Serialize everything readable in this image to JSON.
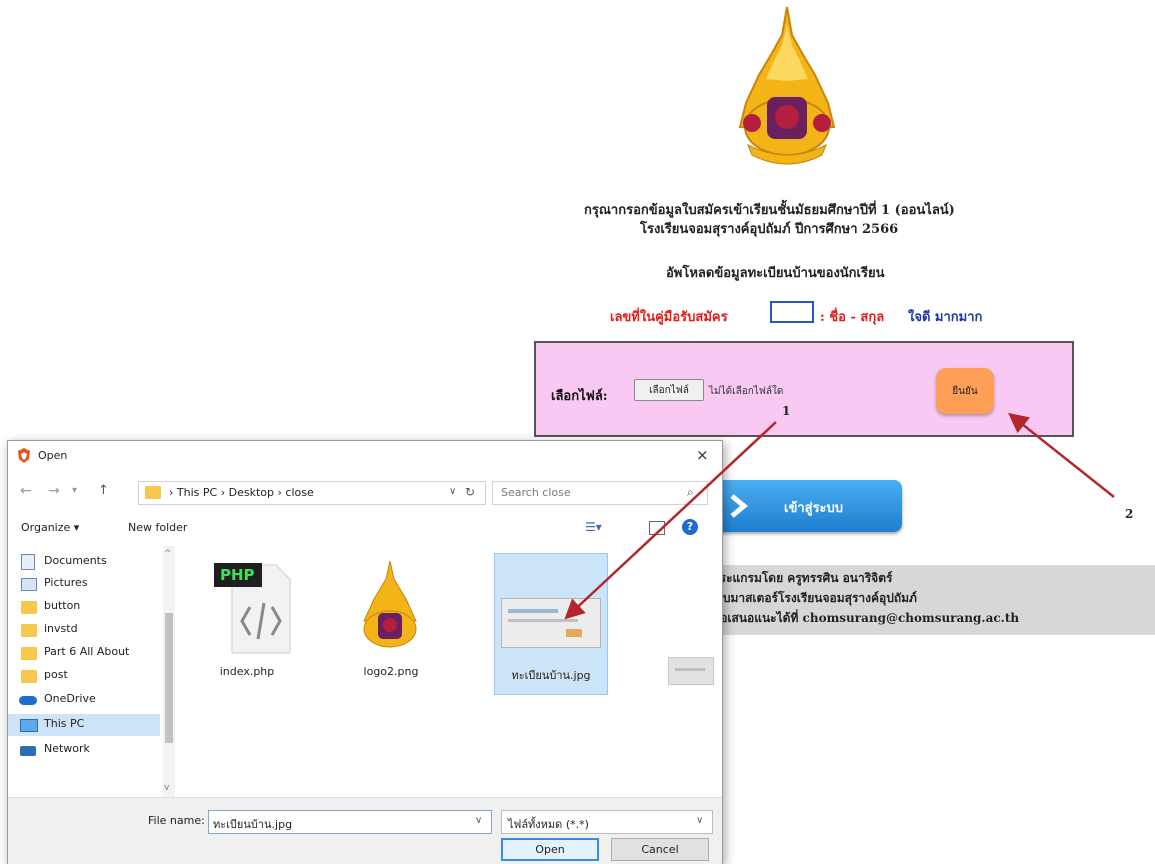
{
  "page": {
    "heading_line1": "กรุณากรอกข้อมูลใบสมัครเข้าเรียนชั้นมัธยมศึกษาปีที่ 1 (ออนไลน์)",
    "heading_line2": "โรงเรียนจอมสุรางค์อุปถัมภ์ ปีการศึกษา 2566",
    "upload_heading": "อัพโหลดข้อมูลทะเบียนบ้านของนักเรียน",
    "reg_label": "เลขที่ในคู่มือรับสมัคร",
    "reg_value": "",
    "name_label": ": ชื่อ - สกุล",
    "name_value": "ใจดี มากมาก",
    "choose_file_label": "เลือกไฟล์:",
    "choose_file_button": "เลือกไฟล์",
    "no_file_text": "ไม่ได้เลือกไฟล์ใด",
    "confirm_button": "ยืนยัน",
    "next_button": "เข้าสู่ระบบ",
    "footer_line1": "ประแกรมโดย ครูทรรศิน อนาริจิตร์",
    "footer_line2": "เว็บมาสเตอร์โรงเรียนจอมสุรางค์อุปถัมภ์",
    "footer_line3": "ข้อเสนอแนะได้ที่ chomsurang@chomsurang.ac.th",
    "annotation1": "1",
    "annotation2": "2",
    "annotation_color": "#b3262e"
  },
  "dialog": {
    "title": "Open",
    "close": "×",
    "breadcrumb": [
      "This PC",
      "Desktop",
      "close"
    ],
    "search_placeholder": "Search close",
    "organize": "Organize ▾",
    "new_folder": "New folder",
    "sidebar": [
      {
        "label": "Documents",
        "icon": "documents-icon"
      },
      {
        "label": "Pictures",
        "icon": "pictures-icon"
      },
      {
        "label": "button",
        "icon": "folder-icon"
      },
      {
        "label": "invstd",
        "icon": "folder-icon"
      },
      {
        "label": "Part 6 All About",
        "icon": "folder-icon"
      },
      {
        "label": "post",
        "icon": "folder-icon"
      },
      {
        "label": "OneDrive",
        "icon": "onedrive-icon"
      },
      {
        "label": "This PC",
        "icon": "this-pc-icon"
      },
      {
        "label": "Network",
        "icon": "network-icon"
      }
    ],
    "files": [
      {
        "name": "index.php",
        "badge": "PHP"
      },
      {
        "name": "logo2.png"
      },
      {
        "name": "ทะเบียนบ้าน.jpg"
      }
    ],
    "file_name_label": "File name:",
    "file_name_value": "ทะเบียนบ้าน.jpg",
    "filter_value": "ไฟล์ทั้งหมด (*.*)",
    "open_button": "Open",
    "cancel_button": "Cancel"
  }
}
